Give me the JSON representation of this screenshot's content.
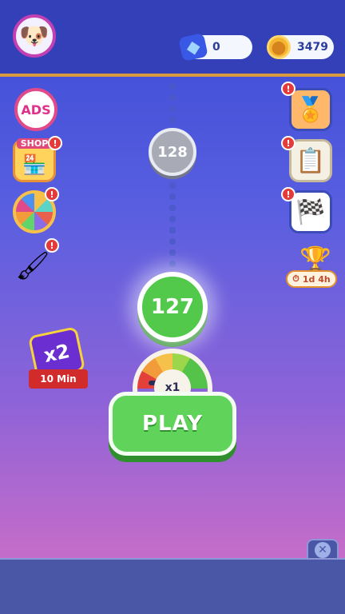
{
  "currency": {
    "gems": "0",
    "coins": "3479"
  },
  "level_map": {
    "next_level": "128",
    "current_level": "127"
  },
  "side_buttons_left": {
    "ads_label": "ADS",
    "shop_label": "SHOP"
  },
  "side_buttons_right": {
    "trophy_timer": "1d 4h"
  },
  "booster": {
    "multiplier": "x2",
    "duration": "10 Min"
  },
  "meter": {
    "multiplier": "x1"
  },
  "play_button": {
    "label": "PLAY"
  },
  "icons": {
    "avatar": "dog-avatar-icon",
    "gem": "gem-icon",
    "coin": "coin-icon",
    "close": "close-icon",
    "alert": "exclamation-icon"
  },
  "colors": {
    "primary_green": "#60d45a",
    "alert_red": "#e33a3a",
    "topbar": "#3340b8"
  }
}
